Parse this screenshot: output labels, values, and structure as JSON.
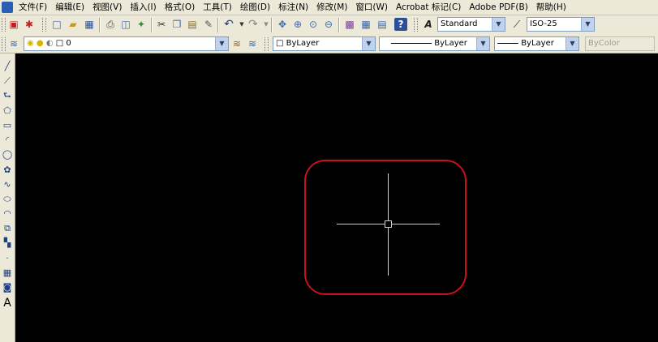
{
  "menubar": {
    "items": [
      "文件(F)",
      "编辑(E)",
      "视图(V)",
      "插入(I)",
      "格式(O)",
      "工具(T)",
      "绘图(D)",
      "标注(N)",
      "修改(M)",
      "窗口(W)",
      "Acrobat 标记(C)",
      "Adobe PDF(B)",
      "帮助(H)"
    ]
  },
  "toolbar_standard": {
    "text_style": "Standard",
    "dim_style": "ISO-25"
  },
  "toolbar_properties": {
    "layer": "0",
    "color": "ByLayer",
    "linetype": "ByLayer",
    "lineweight": "ByLayer",
    "plot_style": "ByColor"
  },
  "left_toolbar": {
    "text_tool_glyph": "A"
  },
  "colors": {
    "canvas": "#000000",
    "highlight_marker": "#c8111b",
    "crosshair": "#cfcfcf"
  },
  "icons": [
    "new-icon",
    "open-icon",
    "save-icon",
    "print-icon",
    "preview-icon",
    "publish-icon",
    "cut-icon",
    "copy-icon",
    "paste-icon",
    "match-icon",
    "undo-icon",
    "redo-icon",
    "pan-icon",
    "zoom-icon",
    "help-icon",
    "line-icon",
    "polygon-icon",
    "circle-icon",
    "text-icon"
  ]
}
